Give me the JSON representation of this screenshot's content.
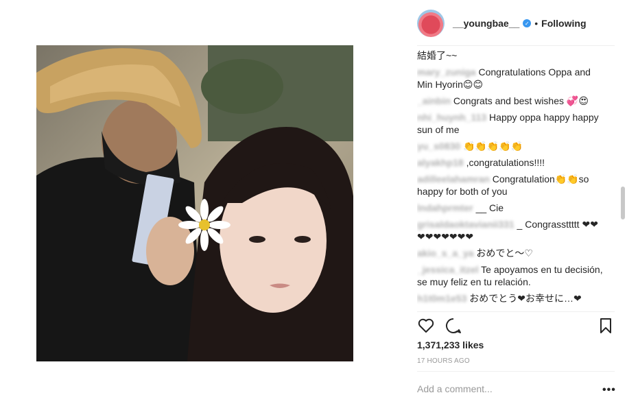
{
  "header": {
    "username": "__youngbae__",
    "verified_mark": "✓",
    "separator": "•",
    "follow_status": "Following"
  },
  "comments": [
    {
      "user": "",
      "text": "結婚了~~"
    },
    {
      "user": "mary_zuniga",
      "text": "Congratulations Oppa and Min Hyorin😊😊"
    },
    {
      "user": "_ainbin",
      "text": "Congrats and best wishes 💞😍"
    },
    {
      "user": "nhi_huynh_113",
      "text": "Happy oppa happy happy sun of me"
    },
    {
      "user": "yu_s0830",
      "text": "👏👏👏👏👏"
    },
    {
      "user": "alyakhp18",
      "text": ",congratulations!!!!"
    },
    {
      "user": "adilleelahamran",
      "text": "Congratulation👏👏so happy for both of you"
    },
    {
      "user": "lndahprmter",
      "text": "__ Cie"
    },
    {
      "user": "grisaldaoktavianii331",
      "text": "_ Congrassttttt ❤❤ ❤❤❤❤❤❤❤"
    },
    {
      "user": "akio_s_a_ya",
      "text": "おめでと～♡"
    },
    {
      "user": "_jessica_itzel",
      "text": "Te apoyamos en tu decisión, se muy feliz en tu relación."
    },
    {
      "user": "h1t0m1e53",
      "text": "おめでとう❤お幸せに…❤"
    }
  ],
  "actions": {
    "like_icon": "heart-outline",
    "comment_icon": "speech-bubble",
    "save_icon": "bookmark"
  },
  "likes": "1,371,233 likes",
  "timestamp": "17 HOURS AGO",
  "comment_input": {
    "placeholder": "Add a comment..."
  },
  "more_options": "•••",
  "colors": {
    "verified": "#3897f0",
    "text": "#262626",
    "muted": "#999999",
    "divider": "#efefef"
  }
}
